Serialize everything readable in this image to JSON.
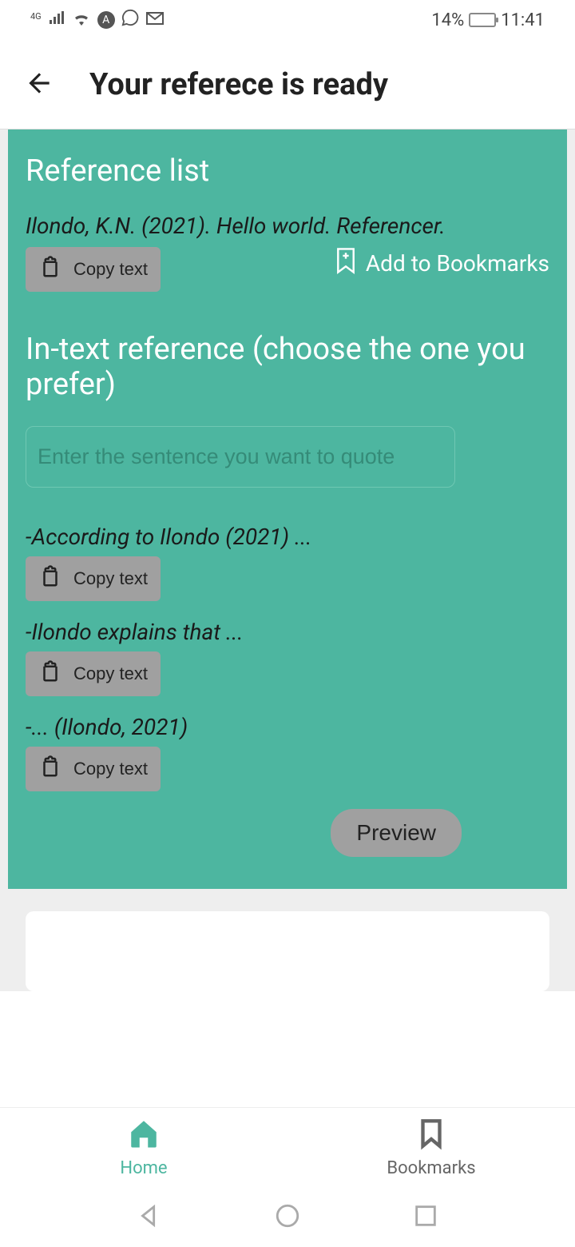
{
  "status": {
    "network": "4G",
    "battery_pct": "14%",
    "time": "11:41"
  },
  "appbar": {
    "title": "Your referece is ready"
  },
  "reference": {
    "section_title": "Reference list",
    "text": "Ilondo, K.N. (2021). Hello world. Referencer.",
    "copy_label": "Copy text",
    "bookmark_label": "Add to Bookmarks"
  },
  "intext": {
    "section_title": "In-text reference (choose the one you prefer)",
    "input_placeholder": "Enter the sentence you want to quote",
    "items": [
      {
        "text": "-According to Ilondo (2021) ..."
      },
      {
        "text": "-Ilondo explains that ..."
      },
      {
        "text": "-... (Ilondo, 2021)"
      }
    ],
    "copy_label": "Copy text",
    "preview_label": "Preview"
  },
  "nav": {
    "home": "Home",
    "bookmarks": "Bookmarks"
  }
}
